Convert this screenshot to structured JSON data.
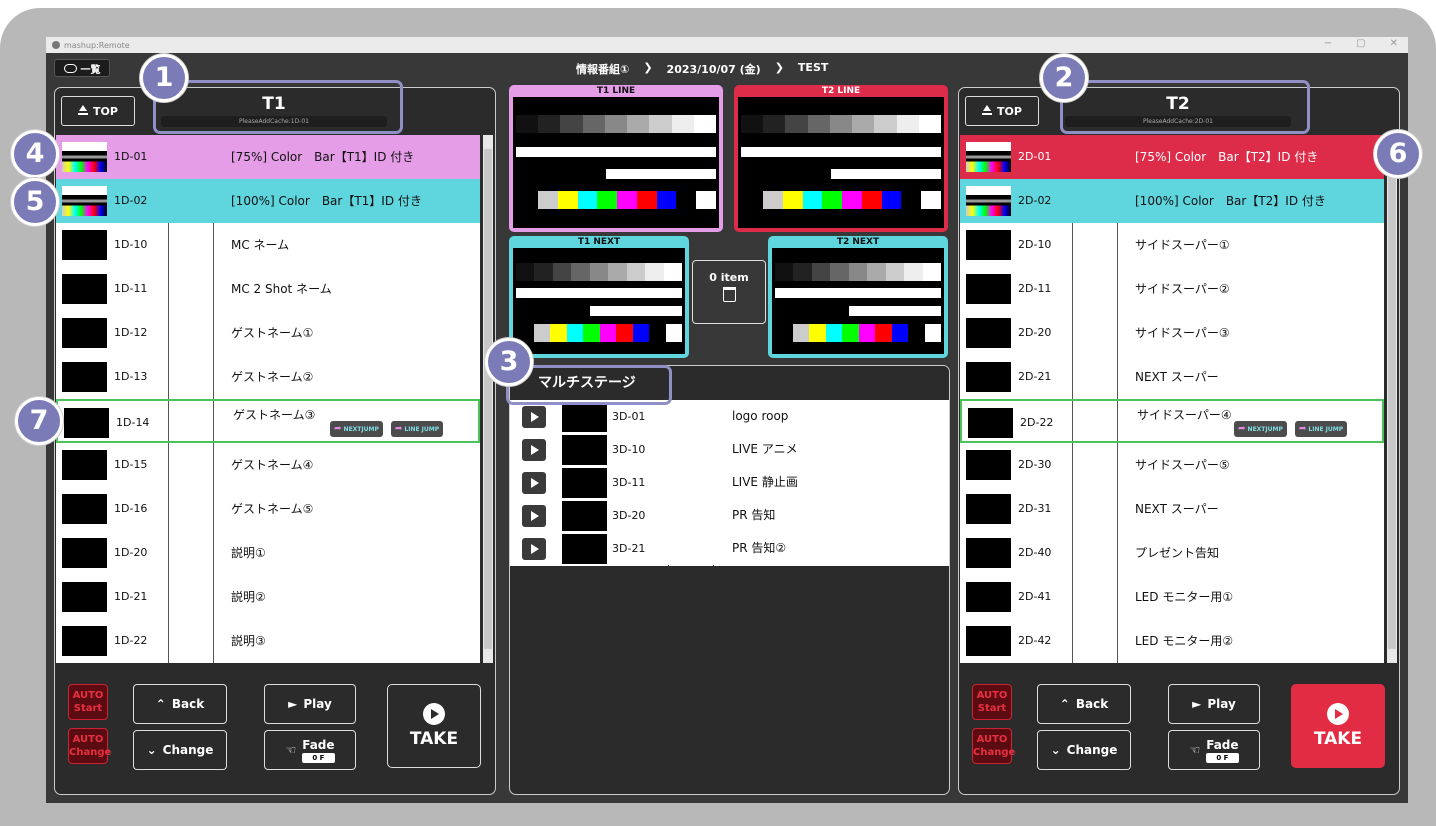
{
  "window": {
    "title": "mashup:Remote",
    "controls": [
      "−",
      "▢",
      "✕"
    ]
  },
  "topbar": {
    "list_label": "一覧",
    "crumbs": [
      "情報番組①",
      "❯",
      "2023/10/07 (金)",
      "❯",
      "TEST"
    ]
  },
  "left": {
    "top_label": "TOP",
    "channel": "T1",
    "cache": "PleaseAddCache:1D-01",
    "rows": [
      {
        "code": "1D-01",
        "title": "[75%] Color　Bar【T1】ID 付き"
      },
      {
        "code": "1D-02",
        "title": "[100%] Color　Bar【T1】ID 付き"
      },
      {
        "code": "1D-10",
        "title": "MC ネーム"
      },
      {
        "code": "1D-11",
        "title": "MC 2 Shot ネーム"
      },
      {
        "code": "1D-12",
        "title": "ゲストネーム①"
      },
      {
        "code": "1D-13",
        "title": "ゲストネーム②"
      },
      {
        "code": "1D-14",
        "title": "ゲストネーム③"
      },
      {
        "code": "1D-15",
        "title": "ゲストネーム④"
      },
      {
        "code": "1D-16",
        "title": "ゲストネーム⑤"
      },
      {
        "code": "1D-20",
        "title": "説明①"
      },
      {
        "code": "1D-21",
        "title": "説明②"
      },
      {
        "code": "1D-22",
        "title": "説明③"
      }
    ]
  },
  "right": {
    "top_label": "TOP",
    "channel": "T2",
    "cache": "PleaseAddCache:2D-01",
    "rows": [
      {
        "code": "2D-01",
        "title": "[75%] Color　Bar【T2】ID 付き"
      },
      {
        "code": "2D-02",
        "title": "[100%] Color　Bar【T2】ID 付き"
      },
      {
        "code": "2D-10",
        "title": "サイドスーパー①"
      },
      {
        "code": "2D-11",
        "title": "サイドスーパー②"
      },
      {
        "code": "2D-20",
        "title": "サイドスーパー③"
      },
      {
        "code": "2D-21",
        "title": "NEXT スーパー"
      },
      {
        "code": "2D-22",
        "title": "サイドスーパー④"
      },
      {
        "code": "2D-30",
        "title": "サイドスーパー⑤"
      },
      {
        "code": "2D-31",
        "title": "NEXT スーパー"
      },
      {
        "code": "2D-40",
        "title": "プレゼント告知"
      },
      {
        "code": "2D-41",
        "title": "LED モニター用①"
      },
      {
        "code": "2D-42",
        "title": "LED モニター用②"
      }
    ]
  },
  "jump": {
    "next": "NEXTJUMP",
    "line": "LINE JUMP"
  },
  "controls": {
    "auto_start": [
      "AUTO",
      "Start"
    ],
    "auto_change": [
      "AUTO",
      "Change"
    ],
    "back": "Back",
    "change": "Change",
    "play": "Play",
    "fade": "Fade",
    "fade_value": "0 F",
    "take": "TAKE"
  },
  "monitors": {
    "t1_line": "T1 LINE",
    "t2_line": "T2 LINE",
    "t1_next": "T1 NEXT",
    "t2_next": "T2 NEXT",
    "item_count": "0 item"
  },
  "stage": {
    "title": "マルチステージ",
    "rows": [
      {
        "code": "3D-01",
        "title": "logo roop"
      },
      {
        "code": "3D-10",
        "title": "LIVE アニメ"
      },
      {
        "code": "3D-11",
        "title": "LIVE 静止画"
      },
      {
        "code": "3D-20",
        "title": "PR 告知"
      },
      {
        "code": "3D-21",
        "title": "PR 告知②"
      }
    ]
  },
  "badges": [
    "1",
    "2",
    "3",
    "4",
    "5",
    "6",
    "7"
  ],
  "colors": {
    "pink": "#e49de6",
    "cyan": "#5fd5dd",
    "red": "#dd2c4a",
    "select": "#4bc35a",
    "badge": "#7b7bb8"
  },
  "icons": {
    "cloud": "cloud-icon",
    "top": "top-arrow-icon",
    "play": "play-icon",
    "trash": "trash-icon",
    "back": "double-chevron-up-icon",
    "change": "double-chevron-down-icon",
    "fade": "fade-hand-icon"
  }
}
